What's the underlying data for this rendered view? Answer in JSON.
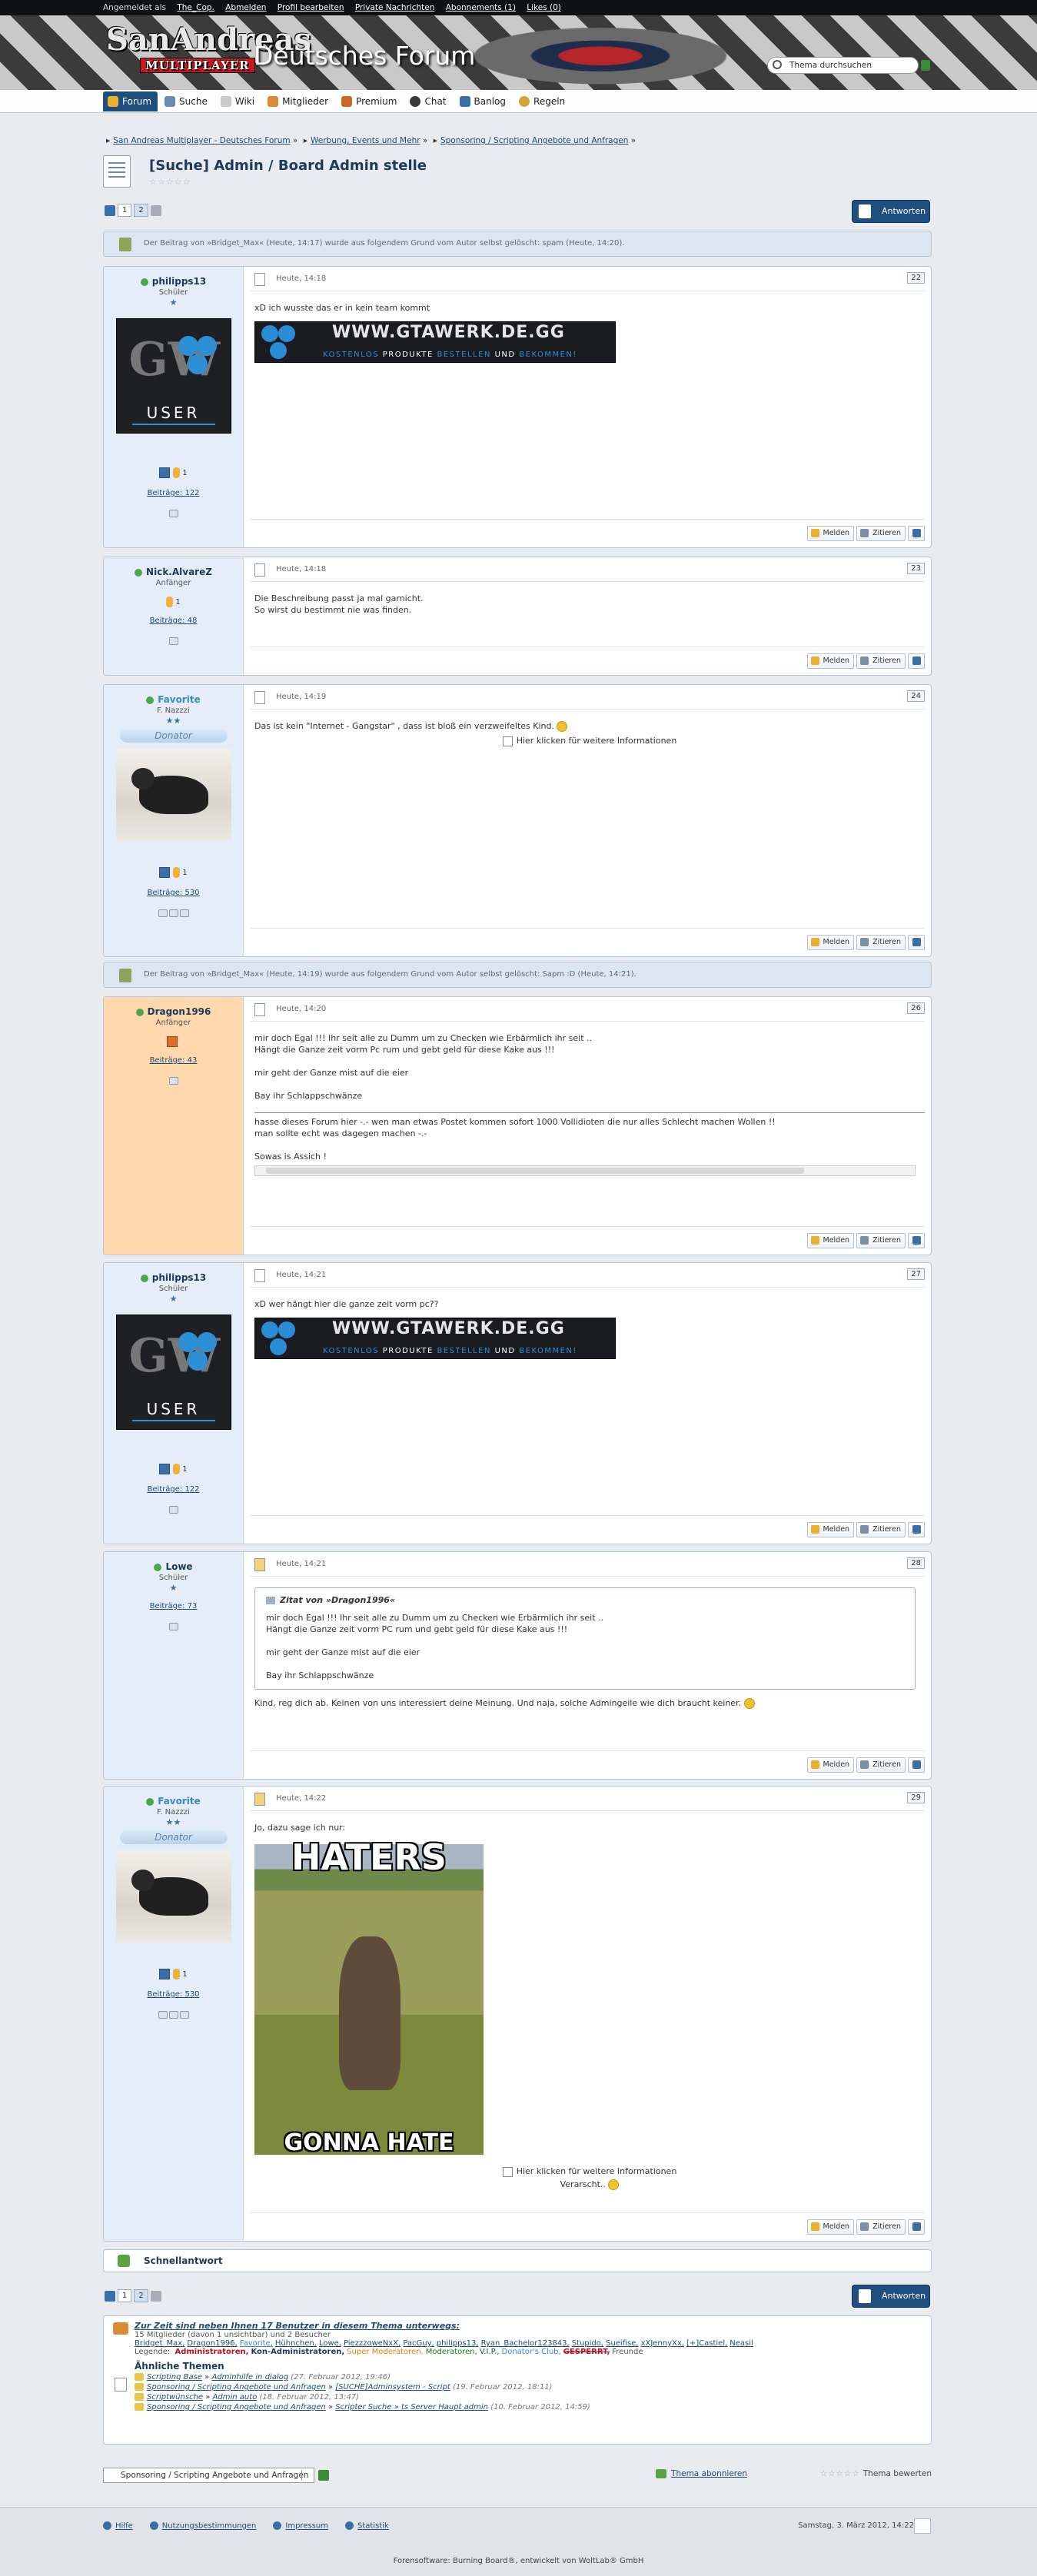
{
  "topbar": {
    "logged_in_prefix": "Angemeldet als",
    "user": "The_Cop.",
    "links": [
      "Abmelden",
      "Profil bearbeiten",
      "Private Nachrichten",
      "Abonnements (1)",
      "Likes (0)"
    ]
  },
  "header": {
    "logo_main": "SanAndreas",
    "logo_sub": "MULTIPLAYER",
    "forum_title": "Deutsches Forum",
    "search_placeholder": "Thema durchsuchen"
  },
  "nav": {
    "tabs": [
      "Forum",
      "Suche",
      "Wiki",
      "Mitglieder",
      "Premium",
      "Chat",
      "Banlog",
      "Regeln"
    ],
    "active": "Forum"
  },
  "breadcrumb": [
    "San Andreas Multiplayer - Deutsches Forum",
    "Werbung, Events und Mehr",
    "Sponsoring / Scripting Angebote und Anfragen"
  ],
  "thread": {
    "title": "[Suche] Admin / Board Admin stelle",
    "rating_stars": "☆☆☆☆☆"
  },
  "pager": {
    "pages": [
      "1",
      "2"
    ],
    "current": "2"
  },
  "reply_label": "Antworten",
  "deleted_notices": [
    "Der Beitrag von »Bridget_Max« (Heute, 14:17) wurde aus folgendem Grund vom Autor selbst gelöscht: spam (Heute, 14:20).",
    "Der Beitrag von »Bridget_Max« (Heute, 14:19) wurde aus folgendem Grund vom Autor selbst gelöscht: Sapm :D (Heute, 14:21)."
  ],
  "actions": {
    "report": "Melden",
    "quote": "Zitieren"
  },
  "posts": [
    {
      "user": "philipps13",
      "rank": "Schüler",
      "stars": "★",
      "count": "1",
      "beitraege": "Beiträge: 122",
      "date": "Heute, 14:18",
      "num": "22",
      "lines": [
        "xD ich wusste das er in kein team kommt"
      ]
    },
    {
      "user": "Nick.AlvareZ",
      "rank": "Anfänger",
      "stars": "",
      "count": "1",
      "beitraege": "Beiträge: 48",
      "date": "Heute, 14:18",
      "num": "23",
      "lines": [
        "Die Beschreibung passt ja mal garnicht.",
        "So wirst du bestimmt nie was finden."
      ]
    },
    {
      "user": "Favorite",
      "rank": "F. Nazzzi",
      "stars": "★★",
      "donator": "Donator",
      "count": "1",
      "beitraege": "Beiträge: 530",
      "date": "Heute, 14:19",
      "num": "24",
      "lines": [
        "Das ist kein \"Internet - Gangstar\" , dass ist bloß ein verzweifeltes Kind."
      ],
      "more": "Hier klicken für weitere Informationen"
    },
    {
      "user": "Dragon1996",
      "rank": "Anfänger",
      "stars": "",
      "count": "",
      "beitraege": "Beiträge: 43",
      "date": "Heute, 14:20",
      "num": "26",
      "lines": [
        "mir doch Egal !!! Ihr seit alle zu Dumm um zu Checken wie Erbärmlich ihr seit ..",
        "Hängt die Ganze zeit vorm Pc rum und gebt geld für diese Kake aus !!!",
        "",
        "mir geht der Ganze mist auf die eier",
        "",
        "Bay ihr Schlappschwänze"
      ],
      "sig": [
        "hasse dieses Forum hier -.- wen man etwas Postet kommen sofort 1000 Vollidioten die nur alles Schlecht machen Wollen !!",
        "man sollte echt was dagegen machen -.-",
        "",
        "Sowas is Assich !"
      ]
    },
    {
      "user": "philipps13",
      "rank": "Schüler",
      "stars": "★",
      "count": "1",
      "beitraege": "Beiträge: 122",
      "date": "Heute, 14:21",
      "num": "27",
      "lines": [
        "xD wer hängt hier die ganze zeit vorm pc??"
      ]
    },
    {
      "user": "Lowe",
      "rank": "Schüler",
      "stars": "★",
      "count": "",
      "beitraege": "Beiträge: 73",
      "date": "Heute, 14:21",
      "num": "28",
      "quote_head": "Zitat von »Dragon1996«",
      "quote_lines": [
        "mir doch Egal !!! Ihr seit alle zu Dumm um zu Checken wie Erbärmlich ihr seit ..",
        "Hängt die Ganze zeit vorm PC rum und gebt geld für diese Kake aus !!!",
        "",
        "mir geht der Ganze mist auf die eier",
        "",
        "Bay ihr Schlappschwänze"
      ],
      "lines": [
        "Kind, reg dich ab. Keinen von uns interessiert deine Meinung. Und naja, solche Admingeile wie dich braucht keiner."
      ]
    },
    {
      "user": "Favorite",
      "rank": "F. Nazzzi",
      "stars": "★★",
      "donator": "Donator",
      "count": "1",
      "beitraege": "Beiträge: 530",
      "date": "Heute, 14:22",
      "num": "29",
      "lines": [
        "Jo, dazu sage ich nur:"
      ],
      "meme_top": "HATERS",
      "meme_bottom": "GONNA HATE",
      "more": "Hier klicken für weitere Informationen",
      "extra": "Verarscht.."
    }
  ],
  "banner": {
    "title": "WWW.GTAWERK.DE.GG",
    "sub_a": "KOSTENLOS ",
    "sub_b": "PRODUKTE",
    "sub_c": " BESTELLEN ",
    "sub_d": "UND",
    "sub_e": " BEKOMMEN!",
    "avatar_user": "USER",
    "avatar_letters": "GW"
  },
  "quick_reply": "Schnellantwort",
  "online": {
    "heading": "Zur Zeit sind neben Ihnen 17 Benutzer in diesem Thema unterwegs:",
    "sub": "15 Mitglieder (davon 1 unsichtbar) und 2 Besucher",
    "names": [
      "Bridget_Max,",
      "Dragon1996,",
      "Favorite,",
      "Hühnchen,",
      "Lowe,",
      "PiezzzoweNxX,",
      "PacGuy,",
      "philipps13,",
      "Ryan_Bachelor123843,",
      "Stupido,",
      "Sueifise,",
      "xXJennyXx,",
      "[+]Castiel,",
      "Neasil"
    ],
    "legend_label": "Legende:",
    "legend": [
      "Administratoren,",
      "Kon-Administratoren,",
      "Super Moderatoren,",
      "Moderatoren,",
      "V.I.P.,",
      "Donator's Club,",
      "GESPERRT,",
      "Freunde"
    ],
    "legend_colors": [
      "#b8141d",
      "#1d3a5a",
      "#e67e00",
      "#1a7a1a",
      "#1d3a5a",
      "#3a88c8",
      "#b8141d",
      "#333333"
    ]
  },
  "similar": {
    "heading": "Ähnliche Themen",
    "items": [
      {
        "board": "Scripting Base",
        "topic": "Adminhilfe in dialog",
        "date": "(27. Februar 2012, 19:46)"
      },
      {
        "board": "Sponsoring / Scripting Angebote und Anfragen",
        "topic": "[SUCHE]Adminsystem - Script",
        "date": "(19. Februar 2012, 18:11)"
      },
      {
        "board": "Scriptwünsche",
        "topic": "Admin auto",
        "date": "(18. Februar 2012, 13:47)"
      },
      {
        "board": "Sponsoring / Scripting Angebote und Anfragen",
        "topic": "Scripter Suche » ts Server Haupt admin",
        "date": "(10. Februar 2012, 14:59)"
      }
    ]
  },
  "bottom": {
    "select_value": "Sponsoring / Scripting Angebote und Anfragen",
    "subscribe": "Thema abonnieren",
    "rate": "Thema bewerten",
    "rate_stars": "☆☆☆☆☆"
  },
  "footer": {
    "links": [
      "Hilfe",
      "Nutzungsbestimmungen",
      "Impressum",
      "Statistik"
    ],
    "clock": "Samstag, 3. März 2012, 14:22",
    "credits": "Forensoftware: Burning Board®, entwickelt von WoltLab® GmbH"
  },
  "colors": {
    "nav_active": "#1d4f7c",
    "link": "#1d4b76",
    "online_dot": "#4aa84a",
    "orange_sidebar": "#ffd9ad"
  }
}
